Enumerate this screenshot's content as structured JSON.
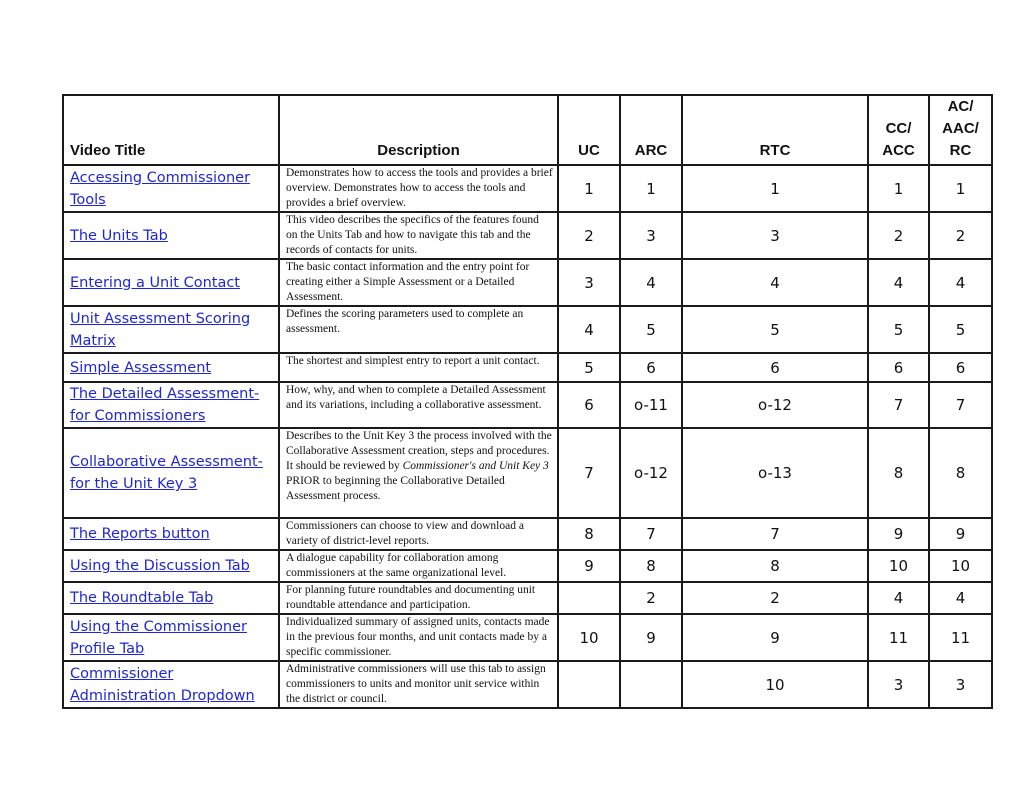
{
  "table": {
    "headers": {
      "video_title": "Video Title",
      "description": "Description",
      "uc": "UC",
      "arc": "ARC",
      "rtc": "RTC",
      "cc_acc": [
        "CC/",
        "ACC"
      ],
      "ac_aac_rc": [
        "AC/",
        "AAC/",
        "RC"
      ]
    },
    "rows": [
      {
        "title": "Accessing Commissioner Tools",
        "description": "Demonstrates how to access the tools and provides a brief overview. Demonstrates how to access the tools and provides a brief overview.",
        "uc": "1",
        "arc": "1",
        "rtc": "1",
        "cc_acc": "1",
        "ac_aac_rc": "1"
      },
      {
        "title": "The Units Tab",
        "description": "This video describes the specifics of the features found on the Units Tab and how to navigate this tab and the records of contacts for units.",
        "uc": "2",
        "arc": "3",
        "rtc": "3",
        "cc_acc": "2",
        "ac_aac_rc": "2"
      },
      {
        "title": "Entering a Unit Contact",
        "description": "The basic contact information and the entry point for creating either a Simple Assessment or a Detailed Assessment.",
        "uc": "3",
        "arc": "4",
        "rtc": "4",
        "cc_acc": "4",
        "ac_aac_rc": "4"
      },
      {
        "title": "Unit Assessment Scoring Matrix",
        "description": "Defines the scoring parameters used to complete an assessment.",
        "uc": "4",
        "arc": "5",
        "rtc": "5",
        "cc_acc": "5",
        "ac_aac_rc": "5"
      },
      {
        "title": "Simple Assessment",
        "description": "The shortest and simplest entry to report a unit contact.",
        "uc": "5",
        "arc": "6",
        "rtc": "6",
        "cc_acc": "6",
        "ac_aac_rc": "6"
      },
      {
        "title": "The Detailed Assessment-for Commissioners",
        "description": "How, why, and when to complete a Detailed Assessment and its variations, including a collaborative assessment.",
        "uc": "6",
        "arc": "o-11",
        "rtc": "o-12",
        "cc_acc": "7",
        "ac_aac_rc": "7"
      },
      {
        "title": "Collaborative Assessment-for the Unit Key 3",
        "description_parts": {
          "before": "Describes to the Unit Key 3 the process involved with the Collaborative Assessment creation, steps and procedures.  It should be reviewed by ",
          "italic": "Commissioner's and Unit Key 3",
          "after": " PRIOR to beginning the Collaborative Detailed Assessment process."
        },
        "uc": "7",
        "arc": "o-12",
        "rtc": "o-13",
        "cc_acc": "8",
        "ac_aac_rc": "8"
      },
      {
        "title": "The Reports button",
        "description": "Commissioners can choose to view and download a variety of district-level reports.",
        "uc": "8",
        "arc": "7",
        "rtc": "7",
        "cc_acc": "9",
        "ac_aac_rc": "9"
      },
      {
        "title": "Using the Discussion Tab",
        "description": "A dialogue capability for collaboration among commissioners at the same organizational level.",
        "uc": "9",
        "arc": "8",
        "rtc": "8",
        "cc_acc": "10",
        "ac_aac_rc": "10"
      },
      {
        "title": "The Roundtable Tab",
        "description": "For planning future roundtables and documenting unit roundtable attendance and participation.",
        "uc": "",
        "arc": "2",
        "rtc": "2",
        "cc_acc": "4",
        "ac_aac_rc": "4"
      },
      {
        "title": "Using the Commissioner Profile Tab",
        "description": "Individualized summary of assigned units, contacts made in the previous four months, and unit contacts made by a specific commissioner.",
        "uc": "10",
        "arc": "9",
        "rtc": "9",
        "cc_acc": "11",
        "ac_aac_rc": "11"
      },
      {
        "title": "Commissioner Administration Dropdown",
        "description": "Administrative commissioners will use this tab to assign commissioners to units and monitor unit service within the district or council.",
        "uc": "",
        "arc": "",
        "rtc": "10",
        "cc_acc": "3",
        "ac_aac_rc": "3"
      }
    ]
  }
}
